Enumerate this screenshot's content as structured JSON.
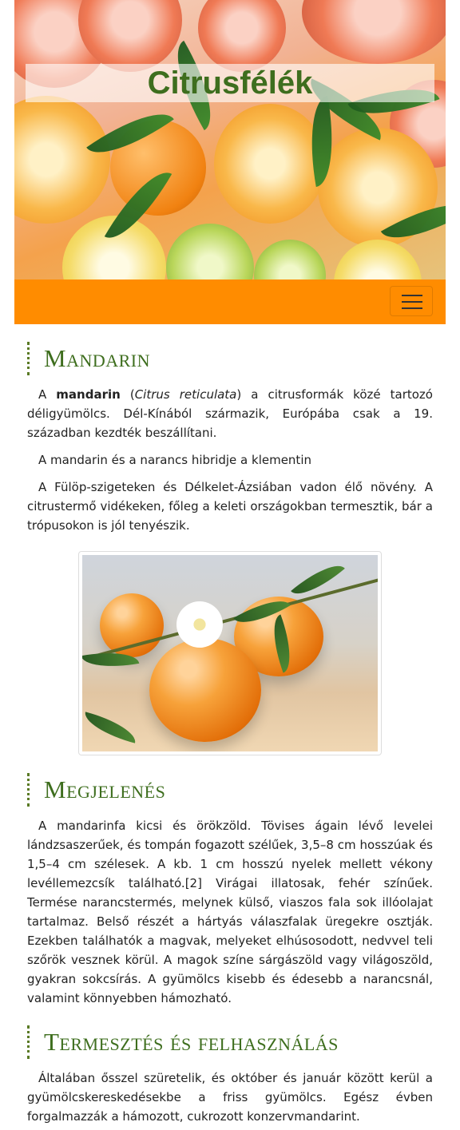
{
  "header": {
    "title": "Citrusfélék"
  },
  "navbar": {
    "toggle_icon": "menu-icon",
    "brand_color": "#ff8c00"
  },
  "sections": [
    {
      "heading": "Mandarin",
      "paragraphs": [
        {
          "prefix": "A ",
          "bold": "mandarin",
          "mid1": " (",
          "italic": "Citrus reticulata",
          "rest": ") a citrusformák közé tartozó déligyümölcs. Dél-Kínából származik, Európába csak a 19. században kezdték beszállítani."
        },
        {
          "text": "A mandarin és a narancs hibridje a klementin"
        },
        {
          "text": "A Fülöp-szigeteken és Délkelet-Ázsiában vadon élő növény. A citrustermő vidékeken, főleg a keleti országokban termesztik, bár a trópusokon is jól tenyészik."
        }
      ]
    },
    {
      "heading": "Megjelenés",
      "paragraphs": [
        {
          "text": "A mandarinfa kicsi és örökzöld. Tövises ágain lévő levelei lándzsaszerűek, és tompán fogazott szélűek, 3,5–8 cm hosszúak és 1,5–4 cm szélesek. A kb. 1 cm hosszú nyelek mellett vékony levéllemezcsík található.[2] Virágai illatosak, fehér színűek. Termése narancstermés, melynek külső, viaszos fala sok illóolajat tartalmaz. Belső részét a hártyás válaszfalak üregekre osztják. Ezekben találhatók a magvak, melyeket elhúsosodott, nedvvel teli szőrök vesznek körül. A magok színe sárgászöld vagy világoszöld, gyakran sokcsírás. A gyümölcs kisebb és édesebb a narancsnál, valamint könnyebben hámozható."
        }
      ]
    },
    {
      "heading": "Termesztés és felhasználás",
      "paragraphs": [
        {
          "text": "Általában ősszel szüretelik, és október és január között kerül a gyümölcskereskedésekbe a friss gyümölcs. Egész évben forgalmazzák a hámozott, cukrozott konzervmandarint."
        }
      ]
    }
  ]
}
